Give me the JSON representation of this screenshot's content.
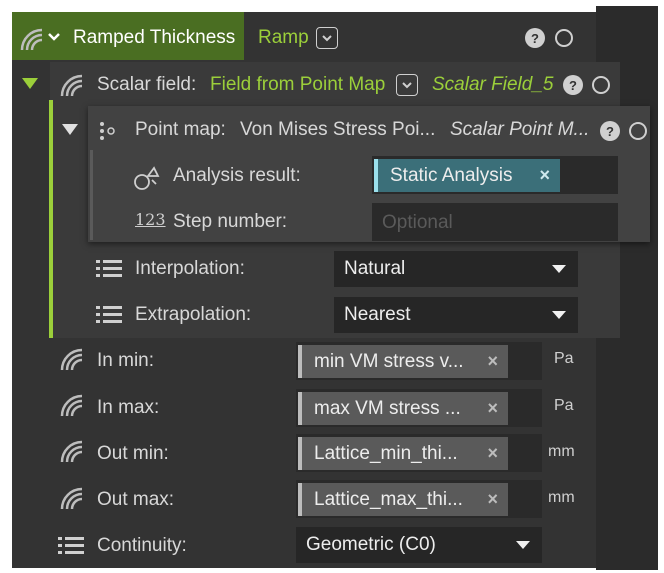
{
  "header": {
    "title": "Ramped Thickness",
    "type_label": "Ramp"
  },
  "scalar_field": {
    "label": "Scalar field:",
    "value": "Field from Point Map",
    "name": "Scalar Field_5"
  },
  "point_map": {
    "label": "Point map:",
    "value": "Von Mises Stress Poi...",
    "name": "Scalar Point M...",
    "analysis_result_label": "Analysis result:",
    "analysis_result_value": "Static Analysis",
    "step_number_label": "Step number:",
    "step_number_placeholder": "Optional",
    "step_icon_text": "123"
  },
  "interpolation": {
    "label": "Interpolation:",
    "value": "Natural"
  },
  "extrapolation": {
    "label": "Extrapolation:",
    "value": "Nearest"
  },
  "in_min": {
    "label": "In min:",
    "value": "min VM stress v...",
    "unit": "Pa"
  },
  "in_max": {
    "label": "In max:",
    "value": "max VM stress ...",
    "unit": "Pa"
  },
  "out_min": {
    "label": "Out min:",
    "value": "Lattice_min_thi...",
    "unit": "mm"
  },
  "out_max": {
    "label": "Out max:",
    "value": "Lattice_max_thi...",
    "unit": "mm"
  },
  "continuity": {
    "label": "Continuity:",
    "value": "Geometric (C0)"
  },
  "icons": {
    "help": "?",
    "remove": "×"
  },
  "colors": {
    "accent_green": "#9bcf3a",
    "header_green": "#4a6e22",
    "chip_teal": "#3b6f79"
  }
}
